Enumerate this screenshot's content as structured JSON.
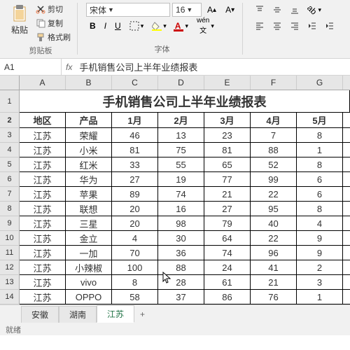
{
  "ribbon": {
    "clipboard": {
      "paste": "粘贴",
      "cut": "剪切",
      "copy": "复制",
      "format": "格式刷",
      "label": "剪贴板"
    },
    "font": {
      "name": "宋体",
      "size": "16",
      "label": "字体",
      "bold": "B",
      "italic": "I",
      "underline": "U"
    }
  },
  "formula": {
    "cell": "A1",
    "fx": "fx",
    "value": "手机销售公司上半年业绩报表"
  },
  "columns": [
    "A",
    "B",
    "C",
    "D",
    "E",
    "F",
    "G"
  ],
  "title": "手机销售公司上半年业绩报表",
  "headers": [
    "地区",
    "产品",
    "1月",
    "2月",
    "3月",
    "4月",
    "5月"
  ],
  "rows": [
    [
      "江苏",
      "荣耀",
      "46",
      "13",
      "23",
      "7",
      "8"
    ],
    [
      "江苏",
      "小米",
      "81",
      "75",
      "81",
      "88",
      "1"
    ],
    [
      "江苏",
      "红米",
      "33",
      "55",
      "65",
      "52",
      "8"
    ],
    [
      "江苏",
      "华为",
      "27",
      "19",
      "77",
      "99",
      "6"
    ],
    [
      "江苏",
      "苹果",
      "89",
      "74",
      "21",
      "22",
      "6"
    ],
    [
      "江苏",
      "联想",
      "20",
      "16",
      "27",
      "95",
      "8"
    ],
    [
      "江苏",
      "三星",
      "20",
      "98",
      "79",
      "40",
      "4"
    ],
    [
      "江苏",
      "金立",
      "4",
      "30",
      "64",
      "22",
      "9"
    ],
    [
      "江苏",
      "一加",
      "70",
      "36",
      "74",
      "96",
      "9"
    ],
    [
      "江苏",
      "小辣椒",
      "100",
      "88",
      "24",
      "41",
      "2"
    ],
    [
      "江苏",
      "vivo",
      "8",
      "28",
      "61",
      "21",
      "3"
    ],
    [
      "江苏",
      "OPPO",
      "58",
      "37",
      "86",
      "76",
      "1"
    ]
  ],
  "tabs": {
    "t1": "安徽",
    "t2": "湖南",
    "t3": "江苏",
    "add": "+"
  },
  "status": "就绪"
}
